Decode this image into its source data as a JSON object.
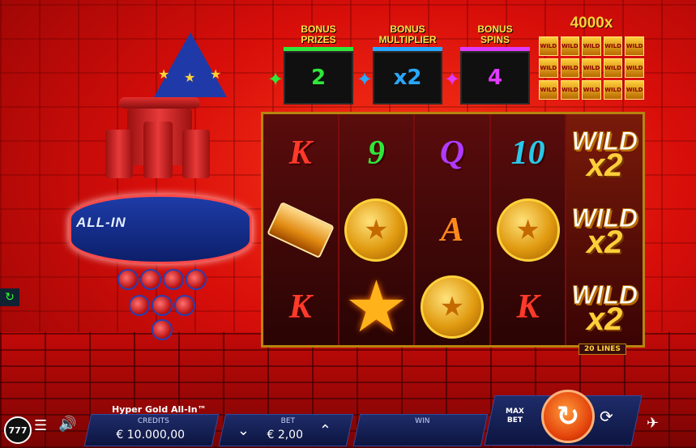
{
  "game": {
    "title": "Hyper Gold All-In™",
    "band_label": "ALL-IN"
  },
  "bonus": [
    {
      "title_line1": "BONUS",
      "title_line2": "PRIZES",
      "value": "2",
      "color": "#2ee83a",
      "bar": "#2ee83a"
    },
    {
      "title_line1": "BONUS",
      "title_line2": "MULTIPLIER",
      "value": "x2",
      "color": "#29a8ff",
      "bar": "#29a8ff"
    },
    {
      "title_line1": "BONUS",
      "title_line2": "SPINS",
      "value": "4",
      "color": "#e03aff",
      "bar": "#e03aff"
    }
  ],
  "jackpot": {
    "multiplier": "4000x",
    "cell_label": "WILD"
  },
  "reels": [
    [
      "K",
      "gold-bar",
      "K"
    ],
    [
      "9",
      "coin",
      "star"
    ],
    [
      "Q",
      "A",
      "coin"
    ],
    [
      "10",
      "coin",
      "K"
    ],
    [
      "WILD x2",
      "WILD x2",
      "WILD x2"
    ]
  ],
  "symbols": {
    "K": "K",
    "Q": "Q",
    "A": "A",
    "nine": "9",
    "ten": "10",
    "wild": "WILD",
    "wild_mult": "x2"
  },
  "lines_label": "20 LINES",
  "bottom": {
    "logo": "777",
    "credits_label": "CREDITS",
    "credits_value": "€ 10.000,00",
    "bet_label": "BET",
    "bet_value": "€ 2,00",
    "win_label": "WIN",
    "win_value": "",
    "max_bet_line1": "MAX",
    "max_bet_line2": "BET"
  }
}
